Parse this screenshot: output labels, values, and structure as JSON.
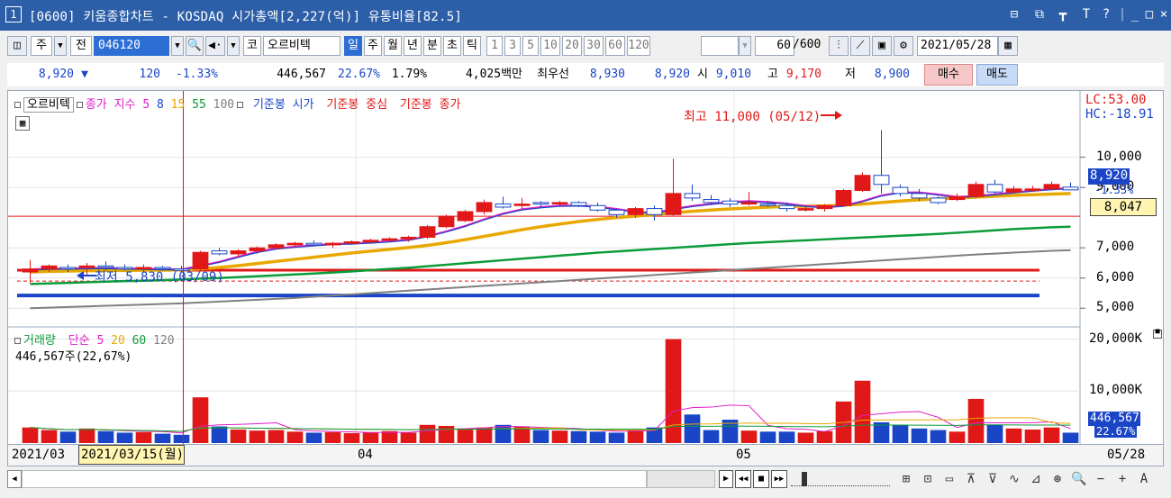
{
  "window": {
    "number": "1",
    "title": "[0600] 키움종합차트 - KOSDAQ 시가총액[2,227(억)] 유통비율[82.5]",
    "controls": [
      "⊟",
      "⧉",
      "┳",
      "T",
      "?",
      "|",
      "_",
      "□",
      "×"
    ]
  },
  "toolbar": {
    "market": "주",
    "prev": "전",
    "code": "046120",
    "kind": "코",
    "stock_name": "오르비텍",
    "periods": [
      "일",
      "주",
      "월",
      "년",
      "분",
      "초",
      "틱"
    ],
    "selected_period": "일",
    "minutes": [
      "1",
      "3",
      "5",
      "10",
      "20",
      "30",
      "60",
      "120"
    ],
    "count": "60",
    "total": "/600",
    "date": "2021/05/28"
  },
  "quote": {
    "price": "8,920",
    "arrow": "▼",
    "change": "120",
    "change_rate": "-1.33%",
    "volume": "446,567",
    "vol_rate": "22.67%",
    "turnover": "1.79%",
    "amount": "4,025백만",
    "best_label": "최우선",
    "best_ask": "8,930",
    "best_bid": "8,920",
    "open_label": "시",
    "open": "9,010",
    "high_label": "고",
    "high": "9,170",
    "low_label": "저",
    "low": "8,900",
    "buy": "매수",
    "sell": "매도"
  },
  "price_legend": {
    "name": "오르비텍",
    "close": "종가",
    "ma_label": "지수",
    "ma5": "5",
    "ma8": "8",
    "ma15": "15",
    "ma55": "55",
    "ma100": "100",
    "ref1": "기준봉 시가",
    "ref2": "기준봉 중심",
    "ref3": "기준봉 종가"
  },
  "price_axis": {
    "lc": "LC:53.00",
    "hc": "HC:-18.91",
    "ticks": [
      "10,000",
      "9,000",
      "7,000",
      "6,000",
      "5,000"
    ],
    "current": "8,920",
    "current_rate": "-1.33%",
    "crosshair": "8,047"
  },
  "annotations": {
    "high": "최고 11,000 (05/12)",
    "low": "최저 5,830 (03/09)"
  },
  "volume_legend": {
    "name": "거래량",
    "ma_label": "단순",
    "ma5": "5",
    "ma20": "20",
    "ma60": "60",
    "ma120": "120",
    "value": "446,567주(22,67%)"
  },
  "volume_axis": {
    "ticks": [
      "20,000K",
      "10,000K"
    ],
    "current": "446,567",
    "rate": "22.67%"
  },
  "date_axis": {
    "labels": [
      "2021/03",
      "04",
      "05"
    ],
    "cursor": "2021/03/15(월)",
    "end": "05/28"
  },
  "colors": {
    "up": "#e01818",
    "down": "#1a45c6",
    "ma5": "#e01ec8",
    "ma8": "#1a45c6",
    "ma15": "#e8a800",
    "ma55": "#0b9b3a",
    "ma100": "#808080"
  },
  "chart_data": {
    "type": "candlestick",
    "price_range": [
      4500,
      11600
    ],
    "volume_max": 20000,
    "candles": [
      [
        6200,
        6600,
        5830,
        6300,
        3000
      ],
      [
        6300,
        6450,
        6200,
        6400,
        2500
      ],
      [
        6350,
        6450,
        6200,
        6300,
        2200
      ],
      [
        6350,
        6500,
        6100,
        6400,
        2800
      ],
      [
        6400,
        6550,
        6250,
        6350,
        2300
      ],
      [
        6350,
        6450,
        6250,
        6300,
        2000
      ],
      [
        6300,
        6450,
        6200,
        6350,
        2100
      ],
      [
        6350,
        6400,
        6250,
        6300,
        1800
      ],
      [
        6300,
        6400,
        6200,
        6250,
        1600
      ],
      [
        6300,
        6900,
        6250,
        6850,
        8800
      ],
      [
        6900,
        7000,
        6750,
        6800,
        3200
      ],
      [
        6800,
        6950,
        6700,
        6900,
        2600
      ],
      [
        6900,
        7050,
        6800,
        7000,
        2400
      ],
      [
        7000,
        7150,
        6950,
        7100,
        2500
      ],
      [
        7100,
        7200,
        7000,
        7150,
        2200
      ],
      [
        7150,
        7250,
        7050,
        7100,
        2000
      ],
      [
        7100,
        7200,
        7000,
        7150,
        2100
      ],
      [
        7150,
        7250,
        7100,
        7200,
        1900
      ],
      [
        7200,
        7300,
        7150,
        7250,
        2000
      ],
      [
        7250,
        7350,
        7200,
        7300,
        2300
      ],
      [
        7300,
        7400,
        7200,
        7350,
        2000
      ],
      [
        7350,
        7750,
        7300,
        7700,
        3500
      ],
      [
        7700,
        8100,
        7650,
        8050,
        3300
      ],
      [
        7900,
        8250,
        7850,
        8200,
        2800
      ],
      [
        8200,
        8600,
        8100,
        8500,
        3000
      ],
      [
        8450,
        8700,
        8300,
        8350,
        3500
      ],
      [
        8400,
        8650,
        8300,
        8450,
        3200
      ],
      [
        8500,
        8550,
        8350,
        8450,
        2500
      ],
      [
        8450,
        8550,
        8350,
        8500,
        2400
      ],
      [
        8500,
        8550,
        8350,
        8400,
        2300
      ],
      [
        8400,
        8500,
        8200,
        8250,
        2200
      ],
      [
        8250,
        8300,
        8000,
        8100,
        2000
      ],
      [
        8100,
        8350,
        8000,
        8300,
        2600
      ],
      [
        8300,
        8400,
        7900,
        8100,
        3000
      ],
      [
        8100,
        9950,
        8050,
        8800,
        21000
      ],
      [
        8800,
        9100,
        8550,
        8650,
        5500
      ],
      [
        8600,
        8750,
        8450,
        8500,
        2500
      ],
      [
        8550,
        8650,
        8350,
        8450,
        4500
      ],
      [
        8450,
        8850,
        8400,
        8500,
        2400
      ],
      [
        8450,
        8550,
        8350,
        8400,
        2200
      ],
      [
        8400,
        8500,
        8200,
        8300,
        2200
      ],
      [
        8250,
        8400,
        8200,
        8300,
        2000
      ],
      [
        8300,
        8450,
        8200,
        8400,
        2300
      ],
      [
        8400,
        8950,
        8400,
        8900,
        8000
      ],
      [
        8900,
        9500,
        8850,
        9400,
        12000
      ],
      [
        9400,
        10900,
        8800,
        9100,
        4000
      ],
      [
        9000,
        9100,
        8700,
        8800,
        3500
      ],
      [
        8800,
        8950,
        8550,
        8650,
        2800
      ],
      [
        8650,
        8700,
        8450,
        8500,
        2500
      ],
      [
        8600,
        8800,
        8550,
        8700,
        2200
      ],
      [
        8700,
        9200,
        8650,
        9100,
        8500
      ],
      [
        9100,
        9250,
        8800,
        8850,
        3500
      ],
      [
        8850,
        9050,
        8800,
        8950,
        2800
      ],
      [
        8950,
        9050,
        8850,
        8950,
        2600
      ],
      [
        8950,
        9200,
        8900,
        9100,
        3000
      ],
      [
        9010,
        9170,
        8900,
        8920,
        2000
      ]
    ],
    "ma5": [
      6300,
      6320,
      6330,
      6340,
      6350,
      6330,
      6320,
      6310,
      6300,
      6420,
      6550,
      6720,
      6880,
      6990,
      7050,
      7100,
      7140,
      7160,
      7190,
      7230,
      7280,
      7400,
      7560,
      7740,
      7960,
      8150,
      8290,
      8360,
      8410,
      8420,
      8380,
      8300,
      8210,
      8170,
      8300,
      8400,
      8470,
      8530,
      8560,
      8530,
      8480,
      8400,
      8360,
      8410,
      8560,
      8750,
      8850,
      8850,
      8780,
      8700,
      8730,
      8790,
      8850,
      8910,
      8960,
      8990
    ],
    "ma15": [
      6200,
      6220,
      6230,
      6240,
      6250,
      6250,
      6260,
      6260,
      6270,
      6300,
      6350,
      6410,
      6480,
      6550,
      6620,
      6690,
      6760,
      6830,
      6890,
      6950,
      7010,
      7080,
      7170,
      7270,
      7380,
      7490,
      7600,
      7700,
      7790,
      7870,
      7940,
      8000,
      8050,
      8100,
      8160,
      8210,
      8250,
      8290,
      8320,
      8350,
      8370,
      8380,
      8390,
      8410,
      8450,
      8500,
      8550,
      8590,
      8620,
      8650,
      8680,
      8710,
      8740,
      8760,
      8780,
      8800
    ],
    "ma55": [
      5800,
      5820,
      5840,
      5860,
      5880,
      5900,
      5910,
      5930,
      5950,
      5980,
      6000,
      6030,
      6060,
      6090,
      6120,
      6150,
      6180,
      6220,
      6260,
      6300,
      6340,
      6390,
      6440,
      6490,
      6540,
      6590,
      6640,
      6690,
      6740,
      6790,
      6840,
      6880,
      6920,
      6960,
      7000,
      7040,
      7080,
      7120,
      7160,
      7190,
      7220,
      7250,
      7280,
      7310,
      7340,
      7370,
      7400,
      7430,
      7460,
      7500,
      7540,
      7580,
      7620,
      7650,
      7680,
      7700
    ],
    "ma100": [
      5000,
      5020,
      5040,
      5060,
      5080,
      5100,
      5120,
      5140,
      5160,
      5190,
      5220,
      5250,
      5280,
      5310,
      5340,
      5380,
      5420,
      5460,
      5500,
      5540,
      5580,
      5620,
      5660,
      5700,
      5740,
      5780,
      5820,
      5860,
      5900,
      5940,
      5980,
      6020,
      6060,
      6100,
      6140,
      6180,
      6220,
      6260,
      6300,
      6340,
      6380,
      6420,
      6460,
      6500,
      6540,
      6580,
      6620,
      6660,
      6700,
      6740,
      6780,
      6810,
      6840,
      6870,
      6900,
      6920
    ],
    "ref_open": 6200,
    "ref_mid": 5900,
    "ref_close": 5600,
    "cursor_index": 8,
    "cursor_price": 8047
  },
  "status": {
    "nav": [
      "▸",
      "◂◂",
      "■",
      "▸▸"
    ],
    "tools": [
      "⊞",
      "⊡",
      "▭",
      "⊼",
      "⊽",
      "∿",
      "⊿",
      "⊛",
      "🔍",
      "−",
      "+",
      "A"
    ]
  }
}
